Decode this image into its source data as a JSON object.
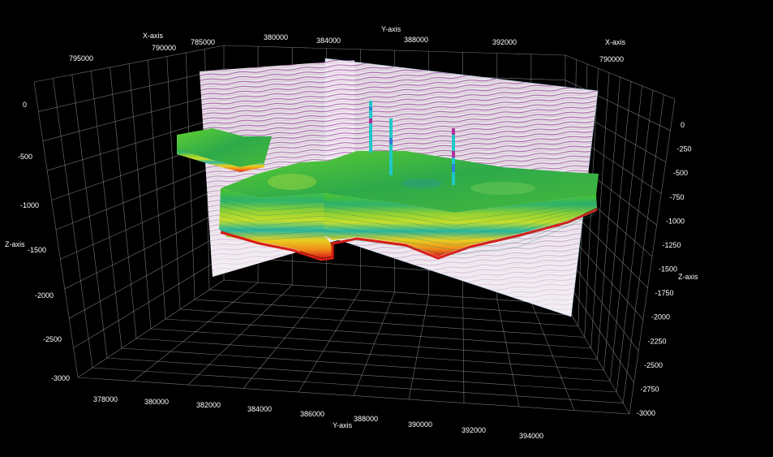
{
  "axes": {
    "x_axis_title": "X-axis",
    "y_axis_title": "Y-axis",
    "z_axis_title": "Z-axis",
    "top_y_ticks": [
      "380000",
      "384000",
      "388000",
      "392000"
    ],
    "top_x_ticks_left": [
      "795000",
      "790000",
      "785000"
    ],
    "top_x_tick_right": "790000",
    "bottom_y_ticks": [
      "378000",
      "380000",
      "382000",
      "384000",
      "386000",
      "388000",
      "390000",
      "392000",
      "394000"
    ],
    "left_z_ticks": [
      "0",
      "-500",
      "-1000",
      "-1500",
      "-2000",
      "-2500",
      "-3000"
    ],
    "right_z_ticks": [
      "0",
      "-250",
      "-500",
      "-750",
      "-1000",
      "-1250",
      "-1500",
      "-1750",
      "-2000",
      "-2250",
      "-2500",
      "-2750",
      "-3000"
    ]
  },
  "scene": {
    "background": "#000000",
    "grid_color": "#9a9a9a",
    "seismic_panel_color": "#f4f0f4",
    "seismic_reflector_color": "#8a1f8c",
    "model_top_color": "#3cba2a",
    "model_base_color": "#e0201a",
    "well_colors": [
      "#20c8c8",
      "#b0309c"
    ]
  }
}
